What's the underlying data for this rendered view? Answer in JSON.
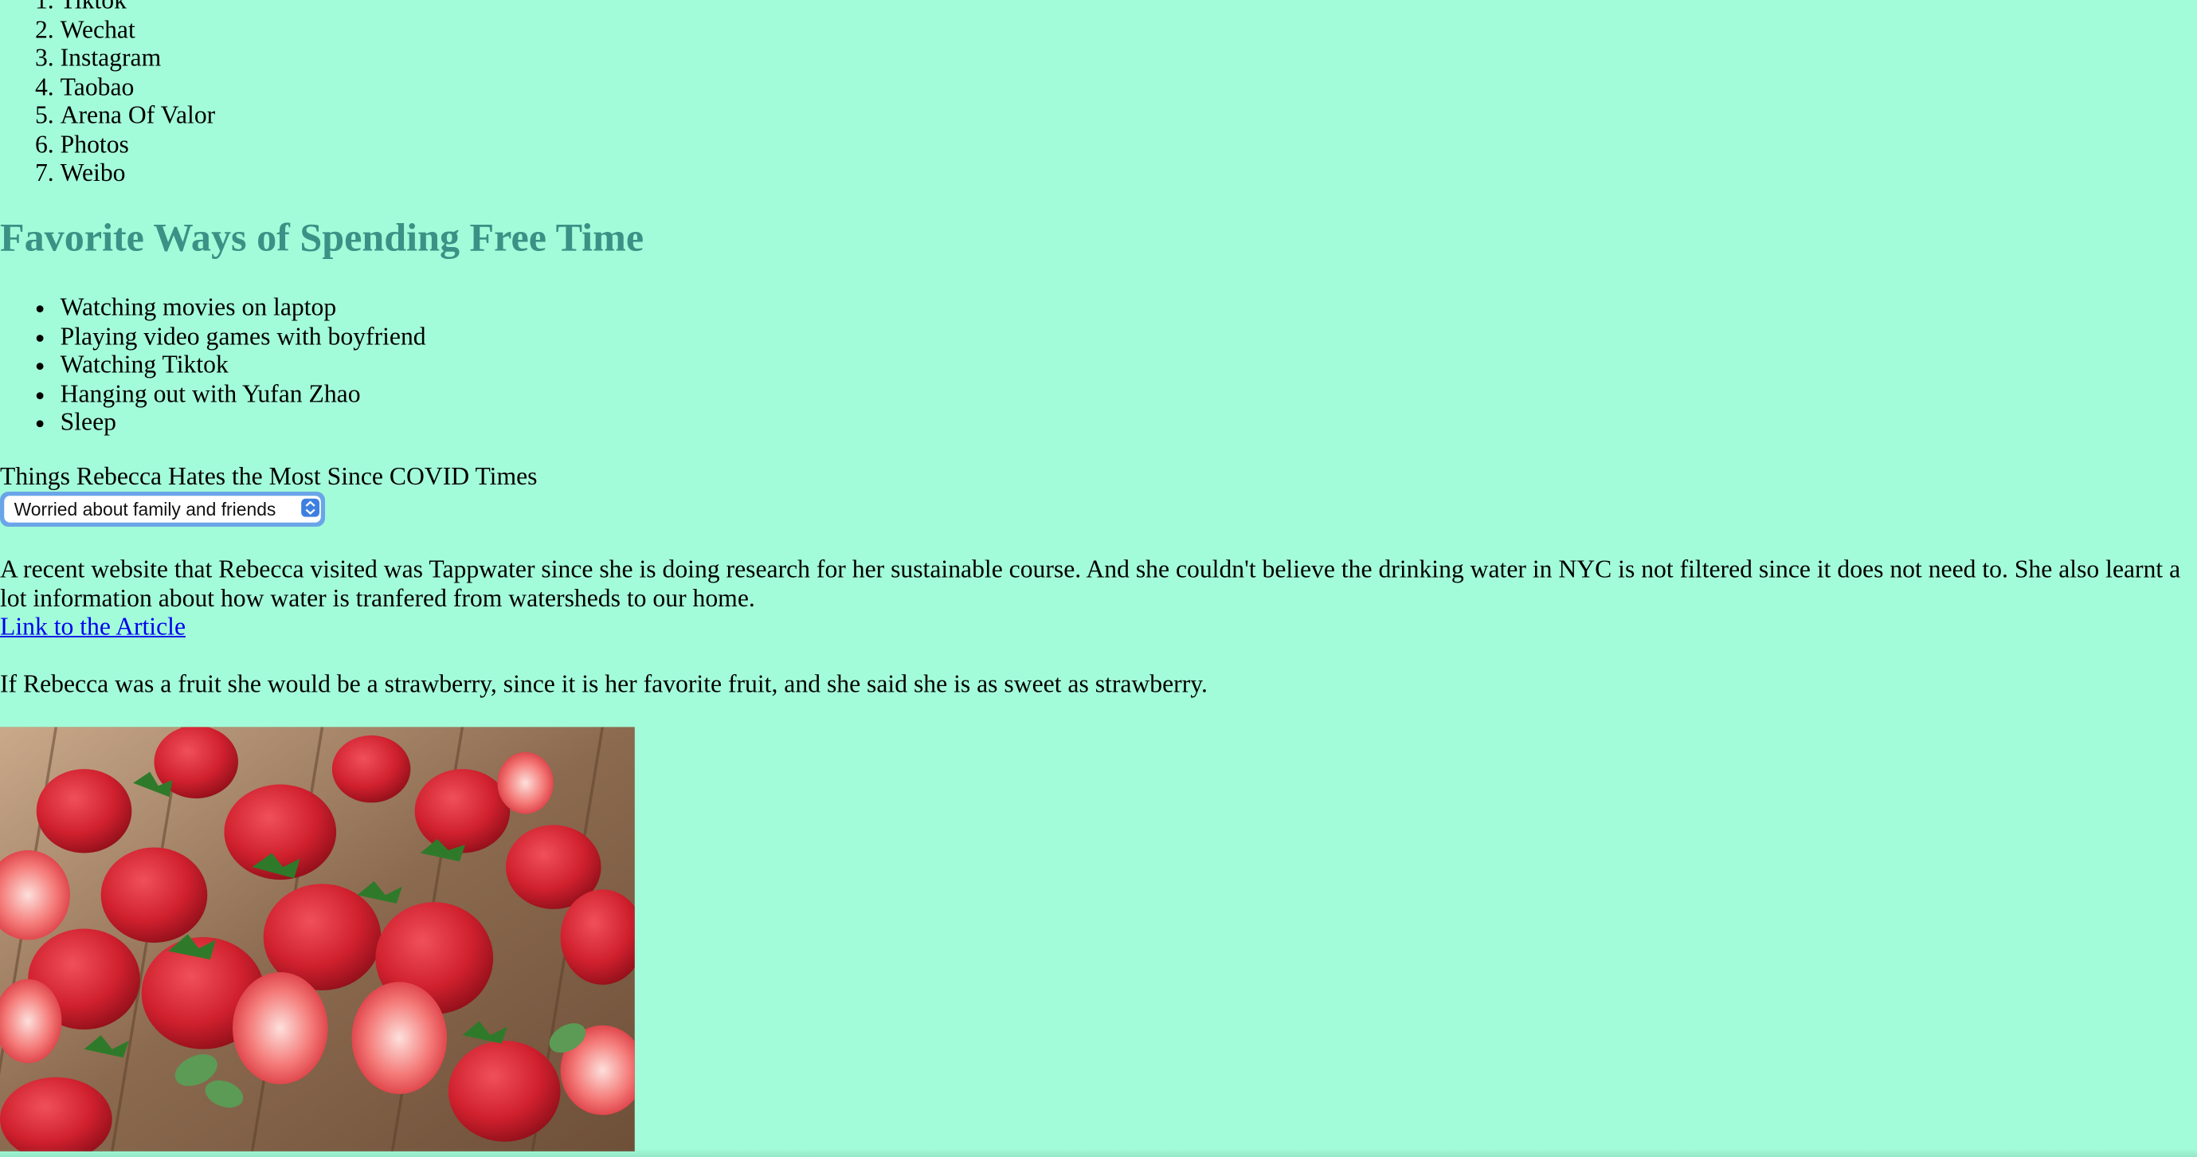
{
  "apps_list": {
    "items": [
      "Tiktok",
      "Wechat",
      "Instagram",
      "Taobao",
      "Arena Of Valor",
      "Photos",
      "Weibo"
    ]
  },
  "free_time": {
    "heading": "Favorite Ways of Spending Free Time",
    "items": [
      "Watching movies on laptop",
      "Playing video games with boyfriend",
      "Watching Tiktok",
      "Hanging out with Yufan Zhao",
      "Sleep"
    ]
  },
  "hates": {
    "label": "Things Rebecca Hates the Most Since COVID Times",
    "selected": "Worried about family and friends"
  },
  "article": {
    "text": "A recent website that Rebecca visited was Tappwater since she is doing research for her sustainable course. And she couldn't believe the drinking water in NYC is not filtered since it does not need to. She also learnt a lot information about how water is tranfered from watersheds to our home.",
    "link_text": "Link to the Article"
  },
  "fruit": {
    "text": "If Rebecca was a fruit she would be a strawberry, since it is her favorite fruit, and she said she is as sweet as strawberry."
  },
  "colors": {
    "background": "#a3fcd9",
    "heading": "#3b9185",
    "link": "#0000ee"
  }
}
